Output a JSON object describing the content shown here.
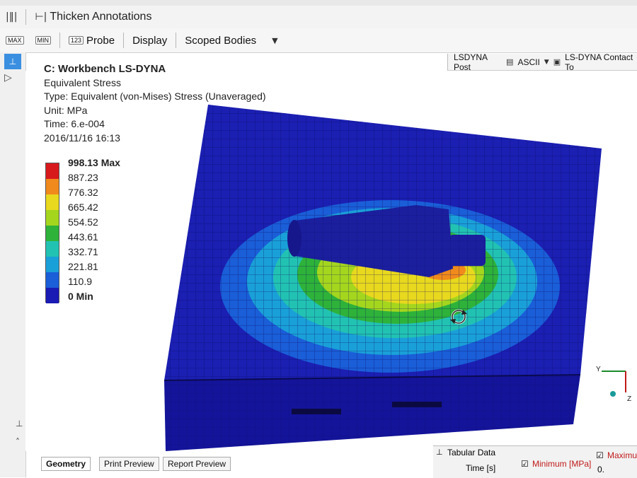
{
  "toolbar1": {
    "thicken_label": "Thicken Annotations"
  },
  "toolbar2": {
    "max_btn": "MAX",
    "min_btn": "MIN",
    "probe_btn_icon": "123",
    "probe_label": "Probe",
    "display_label": "Display",
    "scoped_bodies_label": "Scoped Bodies"
  },
  "results_toolbar": {
    "lsdyna_post": "LSDYNA Post",
    "ascii": "ASCII",
    "contact": "LS-DYNA Contact To"
  },
  "result_info": {
    "title": "C: Workbench LS-DYNA",
    "name": "Equivalent Stress",
    "type": "Type: Equivalent (von-Mises) Stress (Unaveraged)",
    "unit": "Unit: MPa",
    "time": "Time: 6.e-004",
    "timestamp": "2016/11/16 16:13"
  },
  "legend": {
    "max_label": "998.13 Max",
    "levels": [
      "887.23",
      "776.32",
      "665.42",
      "554.52",
      "443.61",
      "332.71",
      "221.81",
      "110.9"
    ],
    "min_label": "0 Min",
    "colors": [
      "#d7191c",
      "#f08a1c",
      "#e8d81e",
      "#a4d61e",
      "#2eb23a",
      "#22c2b2",
      "#1aa0d8",
      "#1a5ed8",
      "#1a1ab4"
    ]
  },
  "axis": {
    "y": "Y",
    "z": "Z"
  },
  "tabs": [
    "Geometry",
    "Print Preview",
    "Report Preview"
  ],
  "tabular": {
    "title": "Tabular Data",
    "col_time": "Time [s]",
    "col_min": "Minimum [MPa]",
    "col_max": "Maximum",
    "row0": "0."
  },
  "colors": {
    "accent": "#3b8fe0",
    "mesh_base": "#1a1ab4"
  }
}
